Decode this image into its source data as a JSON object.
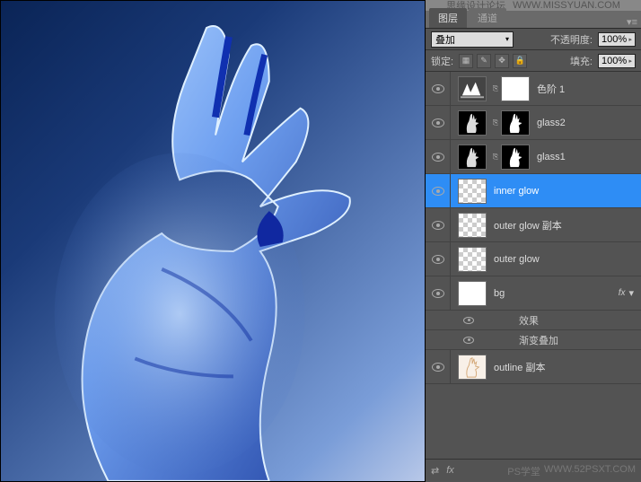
{
  "watermark": {
    "text1": "思缘设计论坛",
    "text2": "WWW.MISSYUAN.COM"
  },
  "tabs": {
    "active": "图层",
    "inactive": "通道"
  },
  "options": {
    "blend_mode": "叠加",
    "opacity_label": "不透明度:",
    "opacity_value": "100%",
    "lock_label": "锁定:",
    "fill_label": "填充:",
    "fill_value": "100%"
  },
  "layers": [
    {
      "name": "色阶 1",
      "type": "adjustment"
    },
    {
      "name": "glass2",
      "type": "masked"
    },
    {
      "name": "glass1",
      "type": "masked"
    },
    {
      "name": "inner glow",
      "type": "normal",
      "selected": true
    },
    {
      "name": "outer glow 副本",
      "type": "normal"
    },
    {
      "name": "outer glow",
      "type": "normal"
    },
    {
      "name": "bg",
      "type": "bg",
      "fx": true
    },
    {
      "name": "outline 副本",
      "type": "outline"
    }
  ],
  "effects": {
    "header": "效果",
    "item": "渐变叠加"
  },
  "footer_watermark": {
    "a": "PS学堂",
    "b": "WWW.52PSXT.COM"
  }
}
